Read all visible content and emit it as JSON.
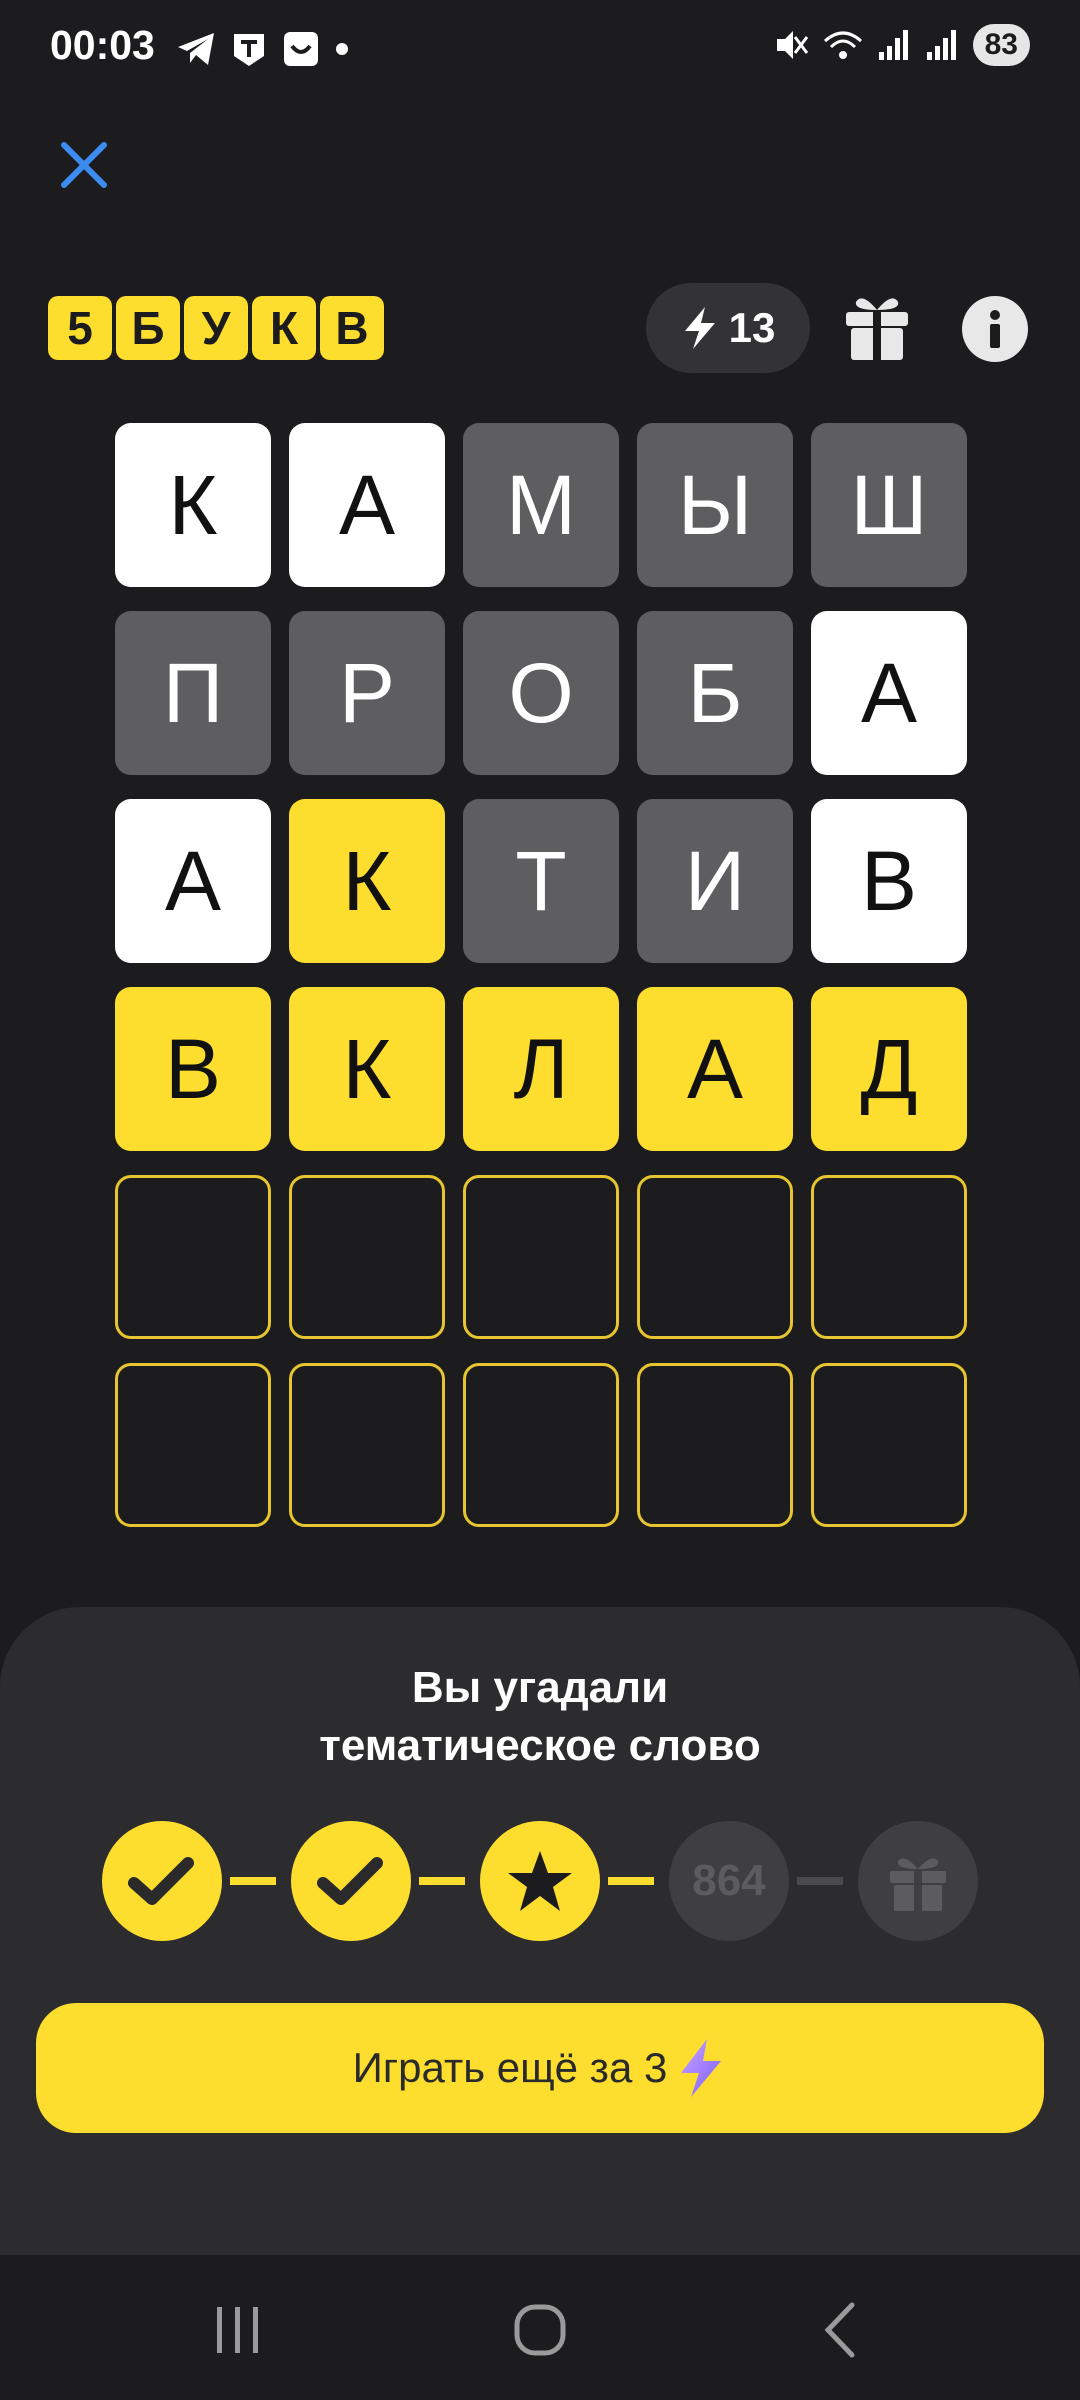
{
  "status_bar": {
    "time": "00:03",
    "battery": "83",
    "icons": [
      "telegram-icon",
      "t-app-icon",
      "smile-app-icon",
      "dot-icon",
      "mute-icon",
      "wifi-icon",
      "signal-icon",
      "signal-icon"
    ]
  },
  "header": {
    "logo_letters": [
      "5",
      "Б",
      "У",
      "К",
      "В"
    ],
    "energy_count": "13"
  },
  "grid": {
    "rows": [
      [
        {
          "l": "К",
          "s": "present"
        },
        {
          "l": "А",
          "s": "present"
        },
        {
          "l": "М",
          "s": "absent"
        },
        {
          "l": "Ы",
          "s": "absent"
        },
        {
          "l": "Ш",
          "s": "absent"
        }
      ],
      [
        {
          "l": "П",
          "s": "absent"
        },
        {
          "l": "Р",
          "s": "absent"
        },
        {
          "l": "О",
          "s": "absent"
        },
        {
          "l": "Б",
          "s": "absent"
        },
        {
          "l": "А",
          "s": "present"
        }
      ],
      [
        {
          "l": "А",
          "s": "present"
        },
        {
          "l": "К",
          "s": "correct"
        },
        {
          "l": "Т",
          "s": "absent"
        },
        {
          "l": "И",
          "s": "absent"
        },
        {
          "l": "В",
          "s": "present"
        }
      ],
      [
        {
          "l": "В",
          "s": "correct"
        },
        {
          "l": "К",
          "s": "correct"
        },
        {
          "l": "Л",
          "s": "correct"
        },
        {
          "l": "А",
          "s": "correct"
        },
        {
          "l": "Д",
          "s": "correct"
        }
      ],
      [
        {
          "l": "",
          "s": "empty"
        },
        {
          "l": "",
          "s": "empty"
        },
        {
          "l": "",
          "s": "empty"
        },
        {
          "l": "",
          "s": "empty"
        },
        {
          "l": "",
          "s": "empty"
        }
      ],
      [
        {
          "l": "",
          "s": "empty"
        },
        {
          "l": "",
          "s": "empty"
        },
        {
          "l": "",
          "s": "empty"
        },
        {
          "l": "",
          "s": "empty"
        },
        {
          "l": "",
          "s": "empty"
        }
      ]
    ]
  },
  "result": {
    "title_line1": "Вы угадали",
    "title_line2": "тематическое слово",
    "progress_next": "864",
    "play_label": "Играть ещё за 3"
  },
  "colors": {
    "accent": "#fddd2e",
    "background": "#1c1c1e",
    "sheet": "#2c2c2e",
    "absent": "#5e5e60"
  }
}
